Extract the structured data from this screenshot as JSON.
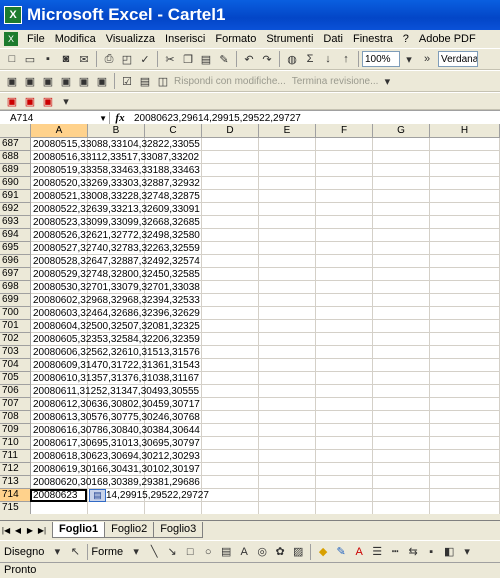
{
  "app": {
    "title": "Microsoft Excel - Cartel1",
    "status": "Pronto"
  },
  "menu": {
    "items": [
      "File",
      "Modifica",
      "Visualizza",
      "Inserisci",
      "Formato",
      "Strumenti",
      "Dati",
      "Finestra",
      "?",
      "Adobe PDF"
    ]
  },
  "toolbar": {
    "zoom": "100%",
    "font": "Verdana",
    "reply_label": "Rispondi con modifiche...",
    "end_review_label": "Termina revisione..."
  },
  "formula_bar": {
    "name_box": "A714",
    "fx": "fx",
    "formula": "20080623,29614,29915,29522,29727"
  },
  "columns": [
    "A",
    "B",
    "C",
    "D",
    "E",
    "F",
    "G",
    "H"
  ],
  "rows": [
    {
      "num": "687",
      "a": "20080515,33088,33104,32822,33055"
    },
    {
      "num": "688",
      "a": "20080516,33112,33517,33087,33202"
    },
    {
      "num": "689",
      "a": "20080519,33358,33463,33188,33463"
    },
    {
      "num": "690",
      "a": "20080520,33269,33303,32887,32932"
    },
    {
      "num": "691",
      "a": "20080521,33008,33228,32748,32875"
    },
    {
      "num": "692",
      "a": "20080522,32639,33213,32609,33091"
    },
    {
      "num": "693",
      "a": "20080523,33099,33099,32668,32685"
    },
    {
      "num": "694",
      "a": "20080526,32621,32772,32498,32580"
    },
    {
      "num": "695",
      "a": "20080527,32740,32783,32263,32559"
    },
    {
      "num": "696",
      "a": "20080528,32647,32887,32492,32574"
    },
    {
      "num": "697",
      "a": "20080529,32748,32800,32450,32585"
    },
    {
      "num": "698",
      "a": "20080530,32701,33079,32701,33038"
    },
    {
      "num": "699",
      "a": "20080602,32968,32968,32394,32533"
    },
    {
      "num": "700",
      "a": "20080603,32464,32686,32396,32629"
    },
    {
      "num": "701",
      "a": "20080604,32500,32507,32081,32325"
    },
    {
      "num": "702",
      "a": "20080605,32353,32584,32206,32359"
    },
    {
      "num": "703",
      "a": "20080606,32562,32610,31513,31576"
    },
    {
      "num": "704",
      "a": "20080609,31470,31722,31361,31543"
    },
    {
      "num": "705",
      "a": "20080610,31357,31376,31038,31167"
    },
    {
      "num": "706",
      "a": "20080611,31252,31347,30493,30555"
    },
    {
      "num": "707",
      "a": "20080612,30636,30802,30459,30717"
    },
    {
      "num": "708",
      "a": "20080613,30576,30775,30246,30768"
    },
    {
      "num": "709",
      "a": "20080616,30786,30840,30384,30644"
    },
    {
      "num": "710",
      "a": "20080617,30695,31013,30695,30797"
    },
    {
      "num": "711",
      "a": "20080618,30623,30694,30212,30293"
    },
    {
      "num": "712",
      "a": "20080619,30166,30431,30102,30197"
    },
    {
      "num": "713",
      "a": "20080620,30168,30389,29381,29686"
    },
    {
      "num": "714",
      "a": "20080623",
      "a_rest": "14,29915,29522,29727"
    },
    {
      "num": "715",
      "a": ""
    }
  ],
  "sheet_tabs": [
    "Foglio1",
    "Foglio2",
    "Foglio3"
  ],
  "draw_toolbar": {
    "draw_label": "Disegno",
    "shapes_label": "Forme"
  }
}
